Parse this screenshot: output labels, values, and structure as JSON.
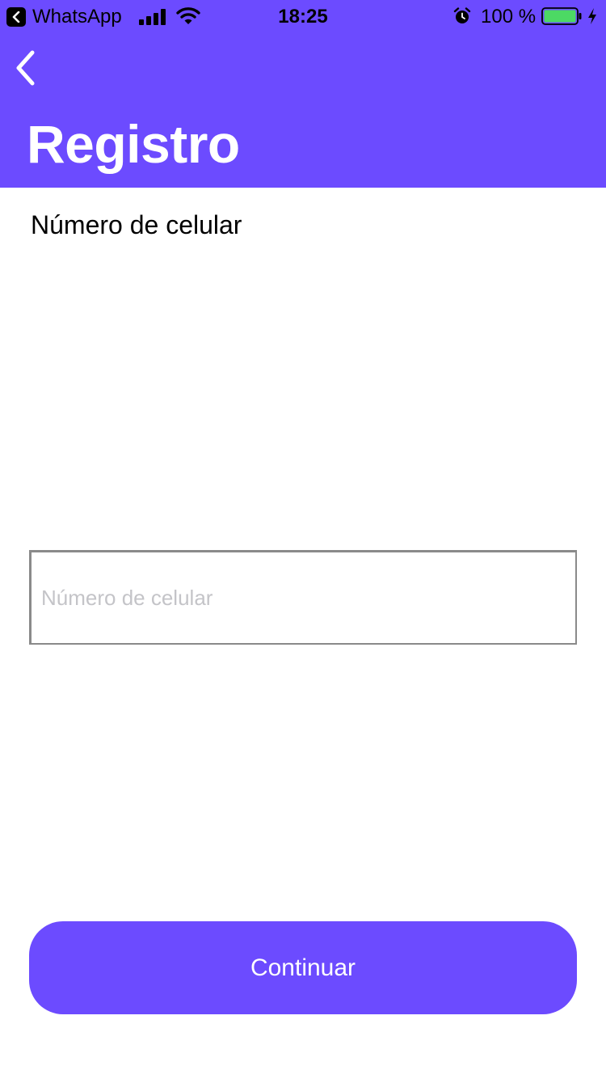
{
  "status_bar": {
    "back_app_label": "WhatsApp",
    "time": "18:25",
    "battery_percent": "100 %",
    "icons": [
      "back-arrow-icon",
      "signal-icon",
      "wifi-icon",
      "alarm-icon",
      "battery-icon",
      "charging-bolt-icon"
    ],
    "battery_fill_fraction": 1.0,
    "battery_color": "#4cd964"
  },
  "header": {
    "back_icon": "chevron-left-icon",
    "title": "Registro",
    "background_color": "#6c4bff"
  },
  "form": {
    "phone_label": "Número de celular",
    "phone_placeholder": "Número de celular",
    "phone_value": ""
  },
  "actions": {
    "continue_label": "Continuar",
    "button_color": "#6c4bff"
  }
}
